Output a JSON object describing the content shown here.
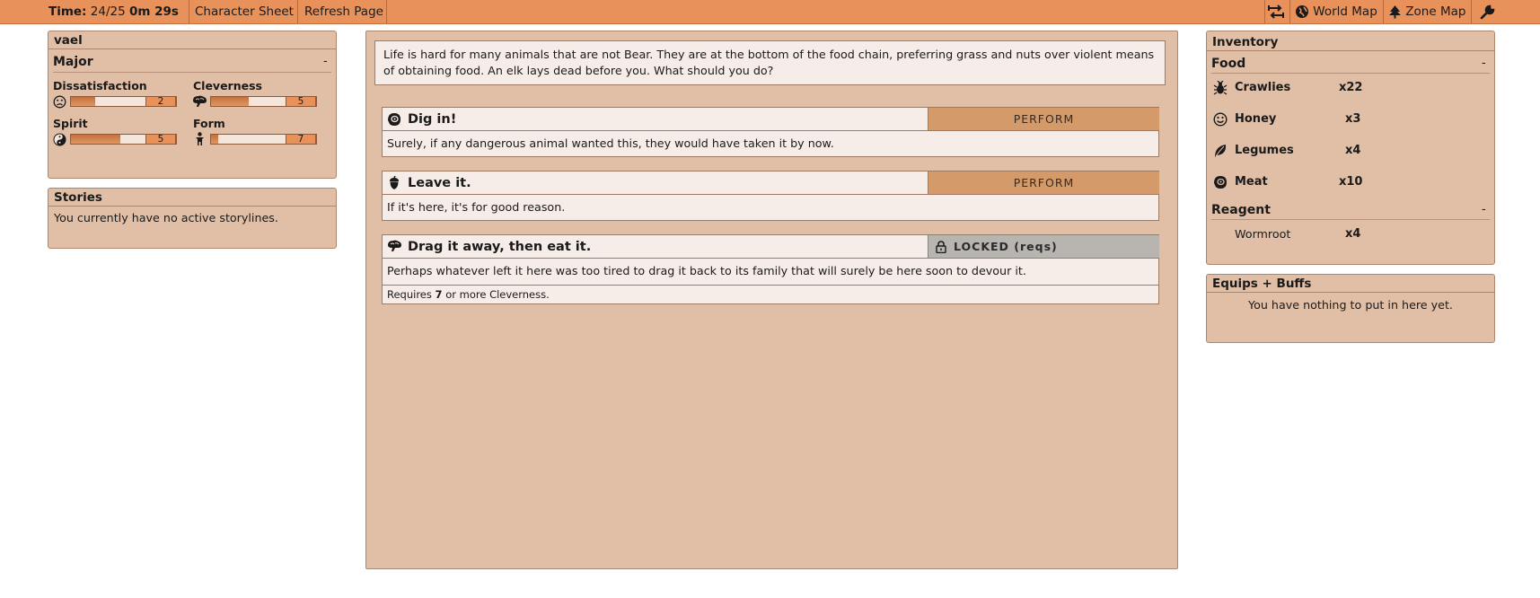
{
  "topbar": {
    "time_label": "Time:",
    "time_value": "24/25",
    "time_remaining": "0m 29s",
    "character_sheet": "Character Sheet",
    "refresh_page": "Refresh Page",
    "world_map": "World Map",
    "zone_map": "Zone Map",
    "icons": [
      "swap-arrows-icon",
      "globe-icon",
      "tree-icon",
      "wrench-icon"
    ]
  },
  "character": {
    "name": "vael",
    "section": "Major",
    "collapse": "-",
    "stats": [
      {
        "label": "Dissatisfaction",
        "value": "2",
        "fill": 0.33,
        "icon": "frown-icon"
      },
      {
        "label": "Cleverness",
        "value": "5",
        "fill": 0.5,
        "icon": "brain-icon"
      },
      {
        "label": "Spirit",
        "value": "5",
        "fill": 0.66,
        "icon": "yin-yang-icon"
      },
      {
        "label": "Form",
        "value": "7",
        "fill": 0.1,
        "icon": "figure-icon"
      }
    ]
  },
  "stories": {
    "title": "Stories",
    "empty": "You currently have no active storylines."
  },
  "storylet": {
    "text": "Life is hard for many animals that are not Bear. They are at the bottom of the food chain, preferring grass and nuts over violent means of obtaining food. An elk lays dead before you. What should you do?",
    "choices": [
      {
        "title": "Dig in!",
        "action": "PERFORM",
        "desc": "Surely, if any dangerous animal wanted this, they would have taken it by now.",
        "icon": "meat-icon"
      },
      {
        "title": "Leave it.",
        "action": "PERFORM",
        "desc": "If it's here, it's for good reason.",
        "icon": "acorn-icon"
      },
      {
        "title": "Drag it away, then eat it.",
        "action": "LOCKED (reqs)",
        "desc": "Perhaps whatever left it here was too tired to drag it back to its family that will surely be here soon to devour it.",
        "req_prefix": "Requires",
        "req_value": "7",
        "req_suffix": "or more Cleverness.",
        "icon": "brain-icon"
      }
    ]
  },
  "inventory": {
    "title": "Inventory",
    "food_label": "Food",
    "reagent_label": "Reagent",
    "collapse": "-",
    "food": [
      {
        "name": "Crawlies",
        "qty": "x22",
        "icon": "bug-icon"
      },
      {
        "name": "Honey",
        "qty": "x3",
        "icon": "smile-icon"
      },
      {
        "name": "Legumes",
        "qty": "x4",
        "icon": "leaf-icon"
      },
      {
        "name": "Meat",
        "qty": "x10",
        "icon": "meat-icon"
      }
    ],
    "reagent": [
      {
        "name": "Wormroot",
        "qty": "x4"
      }
    ]
  },
  "equips": {
    "title": "Equips + Buffs",
    "empty": "You have nothing to put in here yet."
  }
}
